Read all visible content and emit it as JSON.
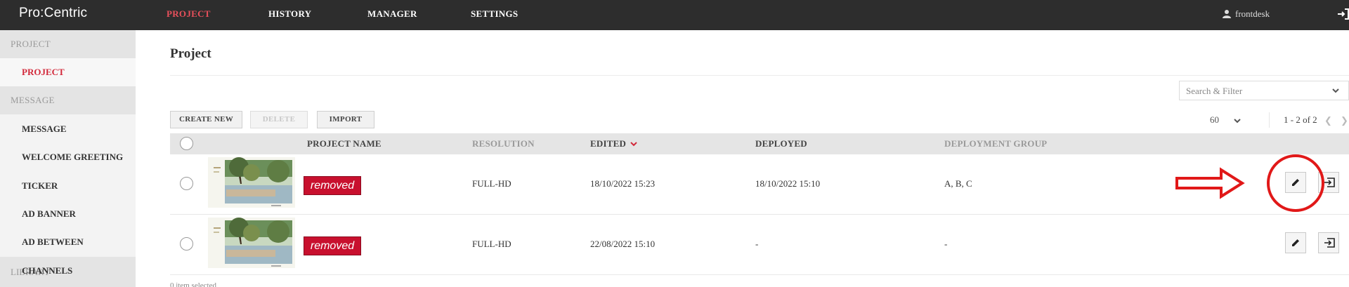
{
  "app": {
    "logo": "Pro:Centric"
  },
  "nav": {
    "items": [
      {
        "label": "PROJECT",
        "active": true
      },
      {
        "label": "HISTORY"
      },
      {
        "label": "MANAGER"
      },
      {
        "label": "SETTINGS"
      }
    ],
    "user": "frontdesk",
    "user_icon": "user-icon",
    "logout_icon": "logout-icon"
  },
  "sidebar": {
    "groups": [
      {
        "label": "PROJECT"
      },
      {
        "label": "MESSAGE"
      }
    ],
    "items": [
      {
        "label": "PROJECT",
        "active": true
      },
      {
        "label": "MESSAGE"
      },
      {
        "label": "WELCOME GREETING"
      },
      {
        "label": "TICKER"
      },
      {
        "label": "AD BANNER"
      },
      {
        "label": "AD BETWEEN"
      },
      {
        "label": "CHANNELS"
      }
    ],
    "overlap_group": "LIBRARY"
  },
  "main": {
    "title": "Project",
    "search_placeholder": "Search & Filter",
    "buttons": {
      "create": "CREATE NEW",
      "delete": "DELETE",
      "import": "IMPORT"
    },
    "per_page": "60",
    "pagination": "1 - 2 of 2",
    "table": {
      "columns": [
        "PROJECT NAME",
        "RESOLUTION",
        "EDITED",
        "DEPLOYED",
        "DEPLOYMENT GROUP"
      ],
      "sorted_column": "EDITED",
      "rows": [
        {
          "tag": "removed",
          "resolution": "FULL-HD",
          "edited": "18/10/2022 15:23",
          "deployed": "18/10/2022 15:10",
          "group": "A, B, C"
        },
        {
          "tag": "removed",
          "resolution": "FULL-HD",
          "edited": "22/08/2022 15:10",
          "deployed": "-",
          "group": "-"
        }
      ]
    },
    "footer": "0 item selected"
  },
  "colors": {
    "topbar": "#2d2d2d",
    "accent": "#d2283a",
    "tag": "#c8102e",
    "annotation": "#e11818"
  }
}
